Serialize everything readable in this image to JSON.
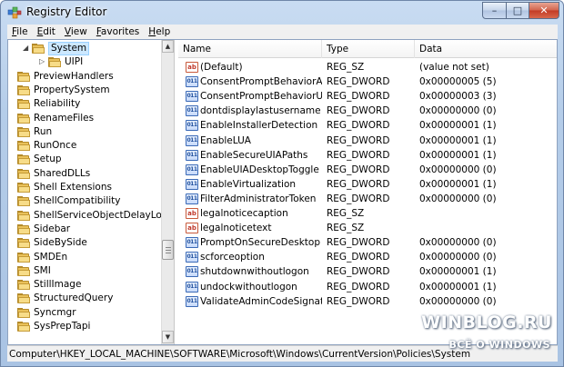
{
  "window": {
    "title": "Registry Editor",
    "controls": {
      "minimize": "–",
      "maximize": "□",
      "close": "✕"
    }
  },
  "menu": [
    {
      "label": "File",
      "mnemonic": "F",
      "rest": "ile"
    },
    {
      "label": "Edit",
      "mnemonic": "E",
      "rest": "dit"
    },
    {
      "label": "View",
      "mnemonic": "V",
      "rest": "iew"
    },
    {
      "label": "Favorites",
      "mnemonic": "F",
      "rest": "avorites"
    },
    {
      "label": "Help",
      "mnemonic": "H",
      "rest": "elp"
    }
  ],
  "tree": {
    "selected_key": "System",
    "items": [
      {
        "label": "System",
        "level": 1,
        "expanded": true,
        "selected": true
      },
      {
        "label": "UIPI",
        "level": 2,
        "expander": "collapsed"
      },
      {
        "label": "PreviewHandlers",
        "level": 0
      },
      {
        "label": "PropertySystem",
        "level": 0
      },
      {
        "label": "Reliability",
        "level": 0
      },
      {
        "label": "RenameFiles",
        "level": 0
      },
      {
        "label": "Run",
        "level": 0
      },
      {
        "label": "RunOnce",
        "level": 0
      },
      {
        "label": "Setup",
        "level": 0
      },
      {
        "label": "SharedDLLs",
        "level": 0
      },
      {
        "label": "Shell Extensions",
        "level": 0
      },
      {
        "label": "ShellCompatibility",
        "level": 0
      },
      {
        "label": "ShellServiceObjectDelayLoad",
        "level": 0
      },
      {
        "label": "Sidebar",
        "level": 0
      },
      {
        "label": "SideBySide",
        "level": 0
      },
      {
        "label": "SMDEn",
        "level": 0
      },
      {
        "label": "SMI",
        "level": 0
      },
      {
        "label": "StillImage",
        "level": 0
      },
      {
        "label": "StructuredQuery",
        "level": 0
      },
      {
        "label": "Syncmgr",
        "level": 0
      },
      {
        "label": "SysPrepTapi",
        "level": 0
      }
    ],
    "scroll_up": "▲",
    "scroll_down": "▼"
  },
  "list": {
    "columns": [
      "Name",
      "Type",
      "Data"
    ],
    "rows": [
      {
        "icon": "string-value-icon",
        "badge": "ab",
        "name": "(Default)",
        "type": "REG_SZ",
        "data": "(value not set)"
      },
      {
        "icon": "dword-value-icon",
        "badge": "011",
        "name": "ConsentPromptBehaviorAd...",
        "type": "REG_DWORD",
        "data": "0x00000005 (5)"
      },
      {
        "icon": "dword-value-icon",
        "badge": "011",
        "name": "ConsentPromptBehaviorUser",
        "type": "REG_DWORD",
        "data": "0x00000003 (3)"
      },
      {
        "icon": "dword-value-icon",
        "badge": "011",
        "name": "dontdisplaylastusername",
        "type": "REG_DWORD",
        "data": "0x00000000 (0)"
      },
      {
        "icon": "dword-value-icon",
        "badge": "011",
        "name": "EnableInstallerDetection",
        "type": "REG_DWORD",
        "data": "0x00000001 (1)"
      },
      {
        "icon": "dword-value-icon",
        "badge": "011",
        "name": "EnableLUA",
        "type": "REG_DWORD",
        "data": "0x00000001 (1)"
      },
      {
        "icon": "dword-value-icon",
        "badge": "011",
        "name": "EnableSecureUIAPaths",
        "type": "REG_DWORD",
        "data": "0x00000001 (1)"
      },
      {
        "icon": "dword-value-icon",
        "badge": "011",
        "name": "EnableUIADesktopToggle",
        "type": "REG_DWORD",
        "data": "0x00000000 (0)"
      },
      {
        "icon": "dword-value-icon",
        "badge": "011",
        "name": "EnableVirtualization",
        "type": "REG_DWORD",
        "data": "0x00000001 (1)"
      },
      {
        "icon": "dword-value-icon",
        "badge": "011",
        "name": "FilterAdministratorToken",
        "type": "REG_DWORD",
        "data": "0x00000000 (0)"
      },
      {
        "icon": "string-value-icon",
        "badge": "ab",
        "name": "legalnoticecaption",
        "type": "REG_SZ",
        "data": ""
      },
      {
        "icon": "string-value-icon",
        "badge": "ab",
        "name": "legalnoticetext",
        "type": "REG_SZ",
        "data": ""
      },
      {
        "icon": "dword-value-icon",
        "badge": "011",
        "name": "PromptOnSecureDesktop",
        "type": "REG_DWORD",
        "data": "0x00000000 (0)"
      },
      {
        "icon": "dword-value-icon",
        "badge": "011",
        "name": "scforceoption",
        "type": "REG_DWORD",
        "data": "0x00000000 (0)"
      },
      {
        "icon": "dword-value-icon",
        "badge": "011",
        "name": "shutdownwithoutlogon",
        "type": "REG_DWORD",
        "data": "0x00000001 (1)"
      },
      {
        "icon": "dword-value-icon",
        "badge": "011",
        "name": "undockwithoutlogon",
        "type": "REG_DWORD",
        "data": "0x00000001 (1)"
      },
      {
        "icon": "dword-value-icon",
        "badge": "011",
        "name": "ValidateAdminCodeSignatures",
        "type": "REG_DWORD",
        "data": "0x00000000 (0)"
      }
    ]
  },
  "status": {
    "path": "Computer\\HKEY_LOCAL_MACHINE\\SOFTWARE\\Microsoft\\Windows\\CurrentVersion\\Policies\\System"
  },
  "watermark": {
    "title": "WINBLOG.RU",
    "subtitle": "ВСЁ О WINDOWS"
  },
  "colors": {
    "frame": "#b5cde9",
    "selection": "#cce8ff",
    "folder": "#e9c15a",
    "close_button": "#c23a24"
  }
}
